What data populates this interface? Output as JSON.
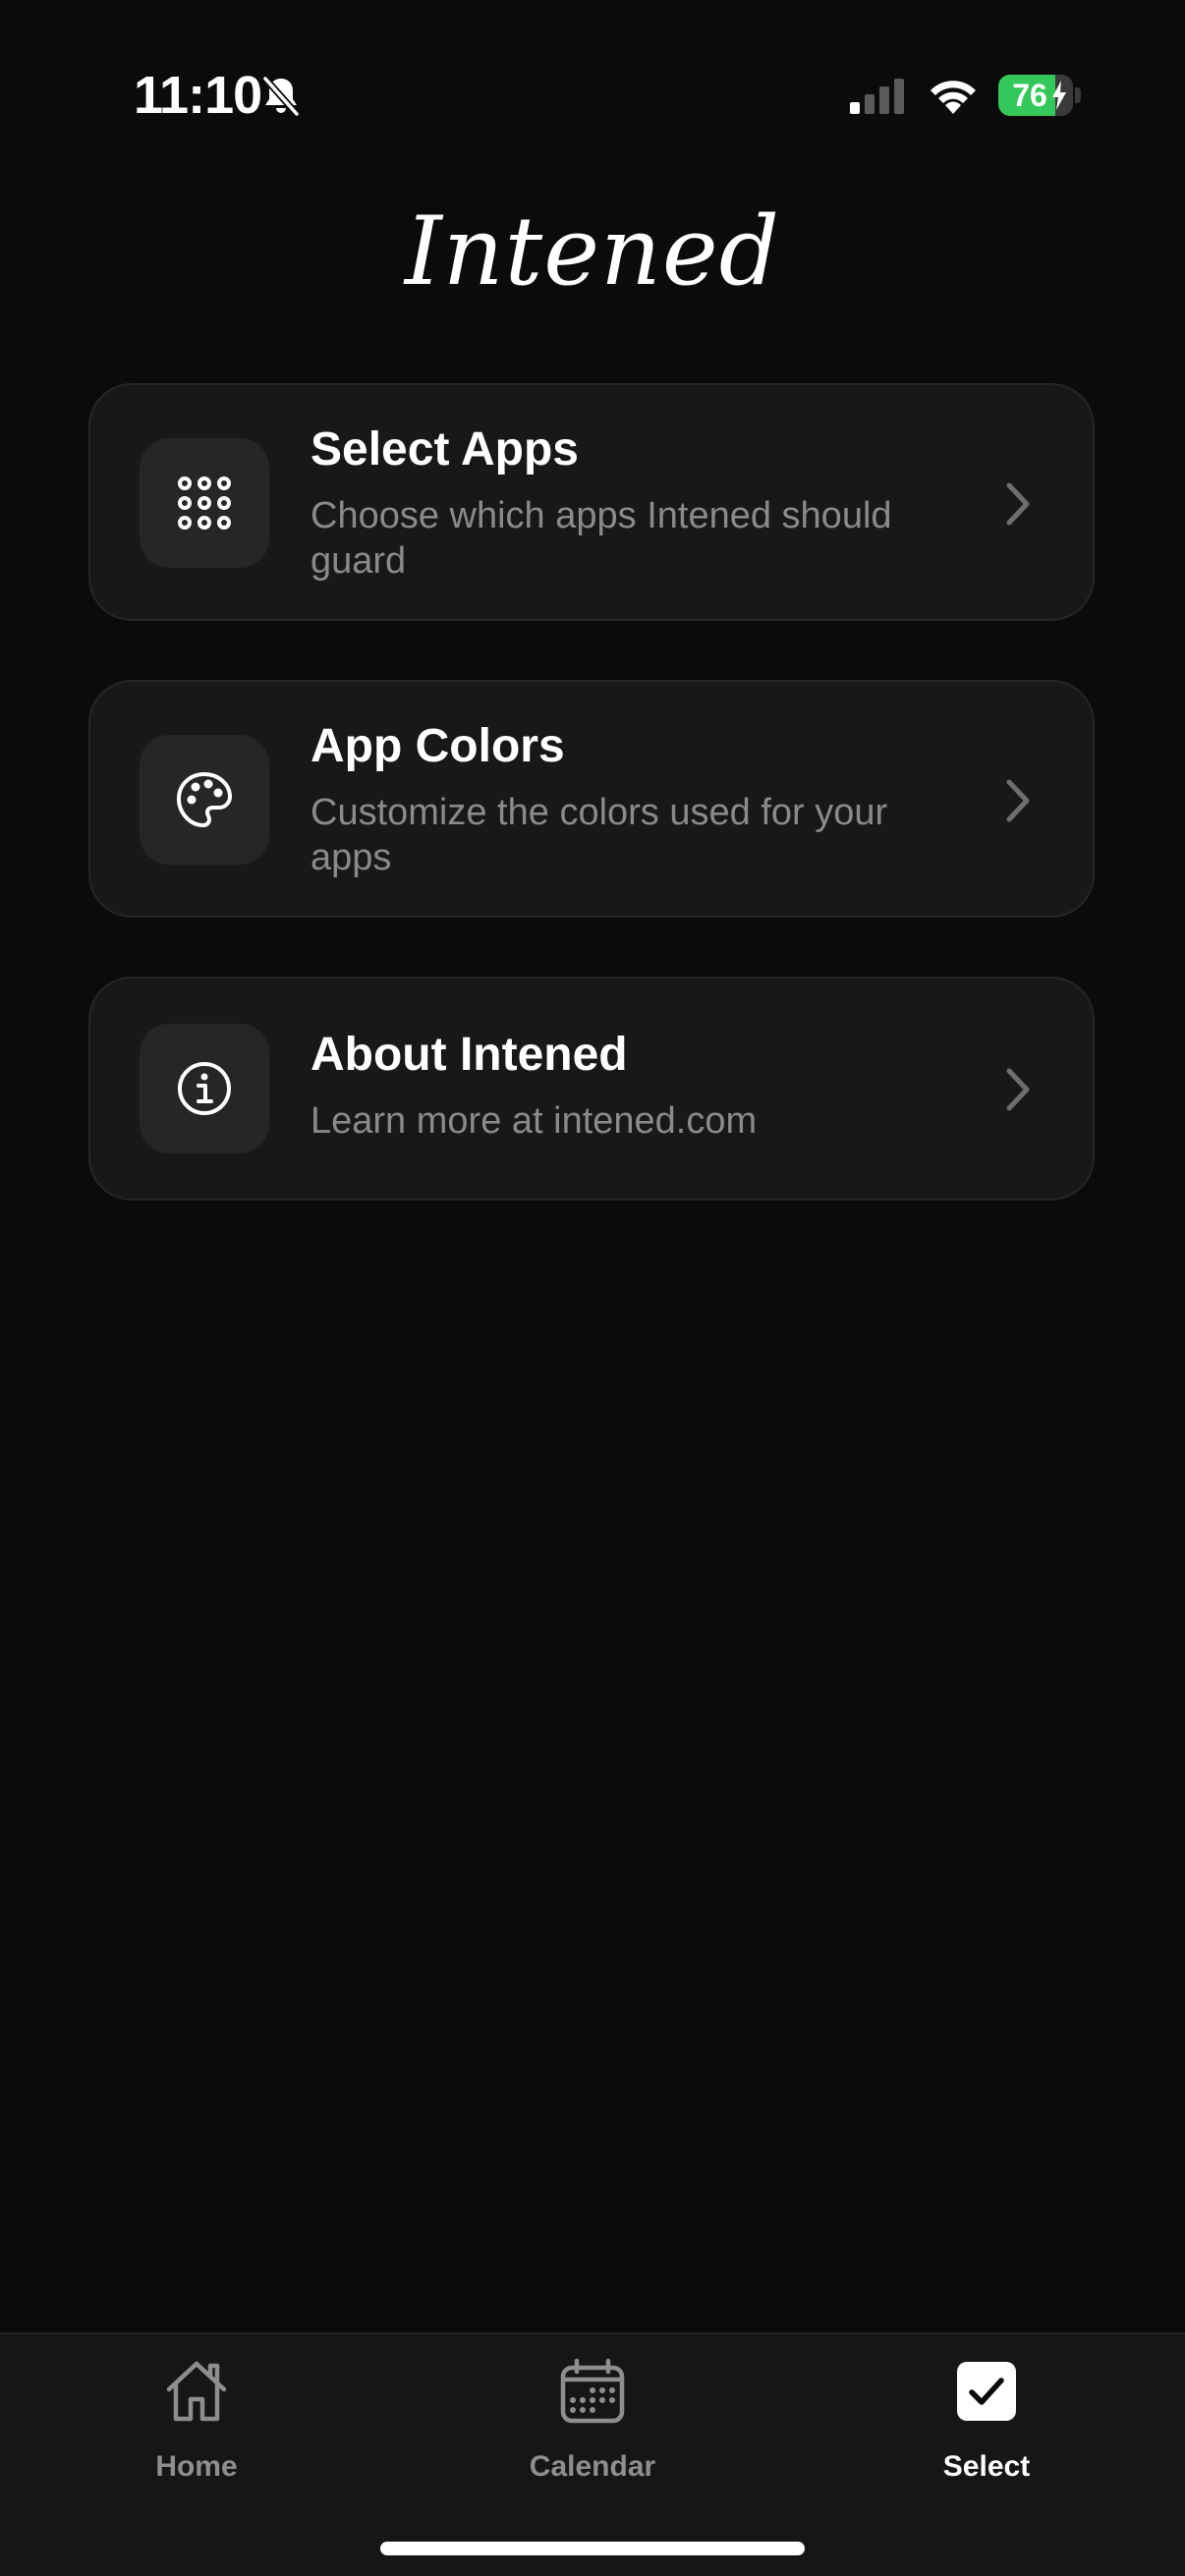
{
  "status_bar": {
    "time": "11:10",
    "battery_percent": "76",
    "battery_level": 0.76,
    "charging": true,
    "icons": [
      "bell-slash-icon",
      "cellular-signal-icon",
      "wifi-icon",
      "battery-icon"
    ]
  },
  "header": {
    "logo_text": "Intened"
  },
  "menu": {
    "items": [
      {
        "title": "Select Apps",
        "subtitle": "Choose which apps Intened should guard",
        "icon": "app-grid-icon"
      },
      {
        "title": "App Colors",
        "subtitle": "Customize the colors used for your apps",
        "icon": "palette-icon"
      },
      {
        "title": "About Intened",
        "subtitle": "Learn more at intened.com",
        "icon": "info-circle-icon"
      }
    ]
  },
  "tab_bar": {
    "tabs": [
      {
        "label": "Home",
        "icon": "house-icon",
        "active": false
      },
      {
        "label": "Calendar",
        "icon": "calendar-icon",
        "active": false
      },
      {
        "label": "Select",
        "icon": "checkmark-square-icon",
        "active": true
      }
    ]
  },
  "colors": {
    "background": "#0b0b0b",
    "card": "#181818",
    "battery_green": "#34c759",
    "subtitle_gray": "#8a8a8a"
  }
}
